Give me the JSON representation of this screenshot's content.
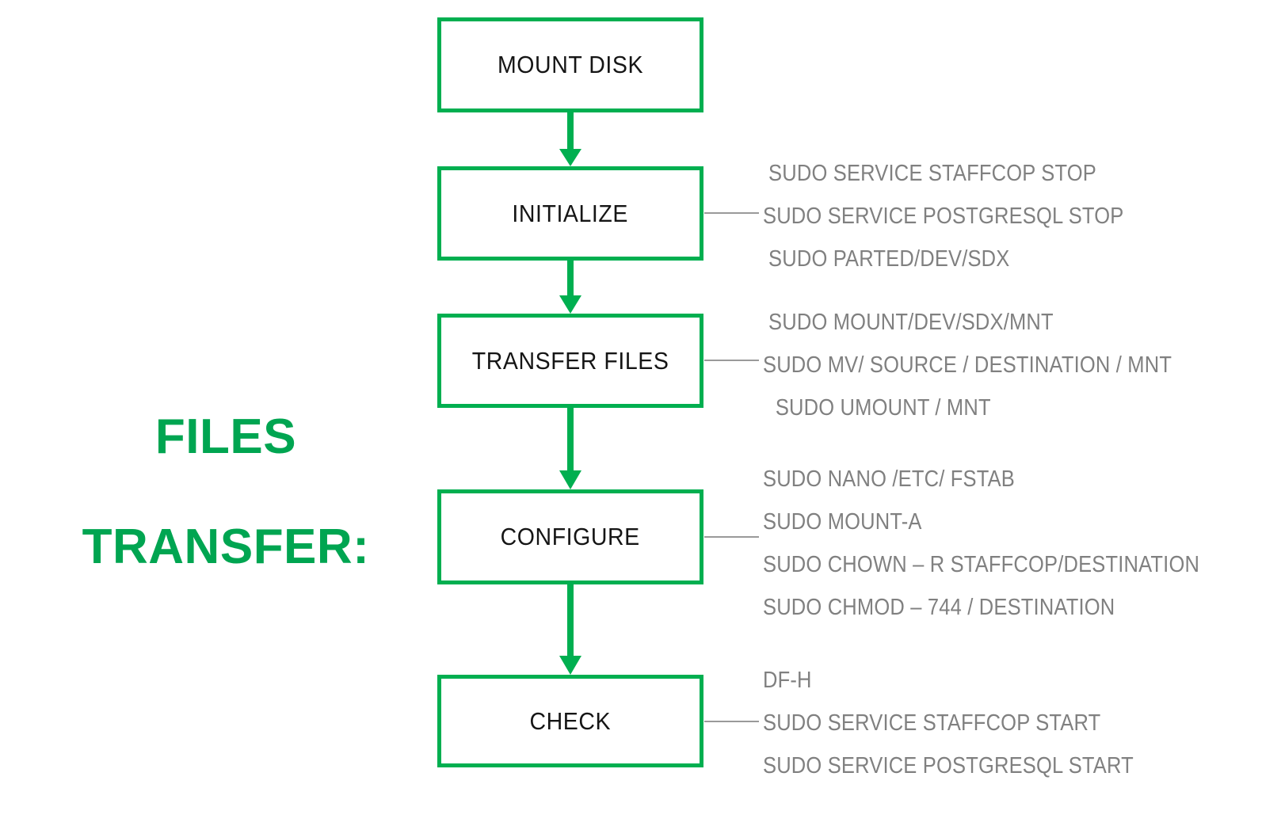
{
  "title": {
    "line1": "FILES",
    "line2": "TRANSFER:"
  },
  "colors": {
    "accent_green": "#00af50",
    "title_green": "#00a551",
    "command_gray": "#808080",
    "node_label": "#151515",
    "connector_gray": "#9a9a9a",
    "background": "#ffffff"
  },
  "nodes": [
    {
      "id": "mount-disk",
      "label": "MOUNT DISK"
    },
    {
      "id": "initialize",
      "label": "INITIALIZE"
    },
    {
      "id": "transfer-files",
      "label": "TRANSFER FILES"
    },
    {
      "id": "configure",
      "label": "CONFIGURE"
    },
    {
      "id": "check",
      "label": "CHECK"
    }
  ],
  "command_groups": [
    {
      "node": "initialize",
      "lines": [
        "SUDO SERVICE STAFFCOP STOP",
        "SUDO SERVICE POSTGRESQL STOP",
        "SUDO PARTED/DEV/SDX"
      ]
    },
    {
      "node": "transfer-files",
      "lines": [
        "SUDO MOUNT/DEV/SDX/MNT",
        "SUDO MV/ SOURCE / DESTINATION / MNT",
        "SUDO UMOUNT / MNT"
      ]
    },
    {
      "node": "configure",
      "lines": [
        "SUDO NANO /ETC/ FSTAB",
        "SUDO MOUNT-A",
        "SUDO CHOWN – R STAFFCOP/DESTINATION",
        "SUDO CHMOD – 744 / DESTINATION"
      ]
    },
    {
      "node": "check",
      "lines": [
        "DF-H",
        "SUDO SERVICE STAFFCOP START",
        "SUDO SERVICE POSTGRESQL START"
      ]
    }
  ]
}
